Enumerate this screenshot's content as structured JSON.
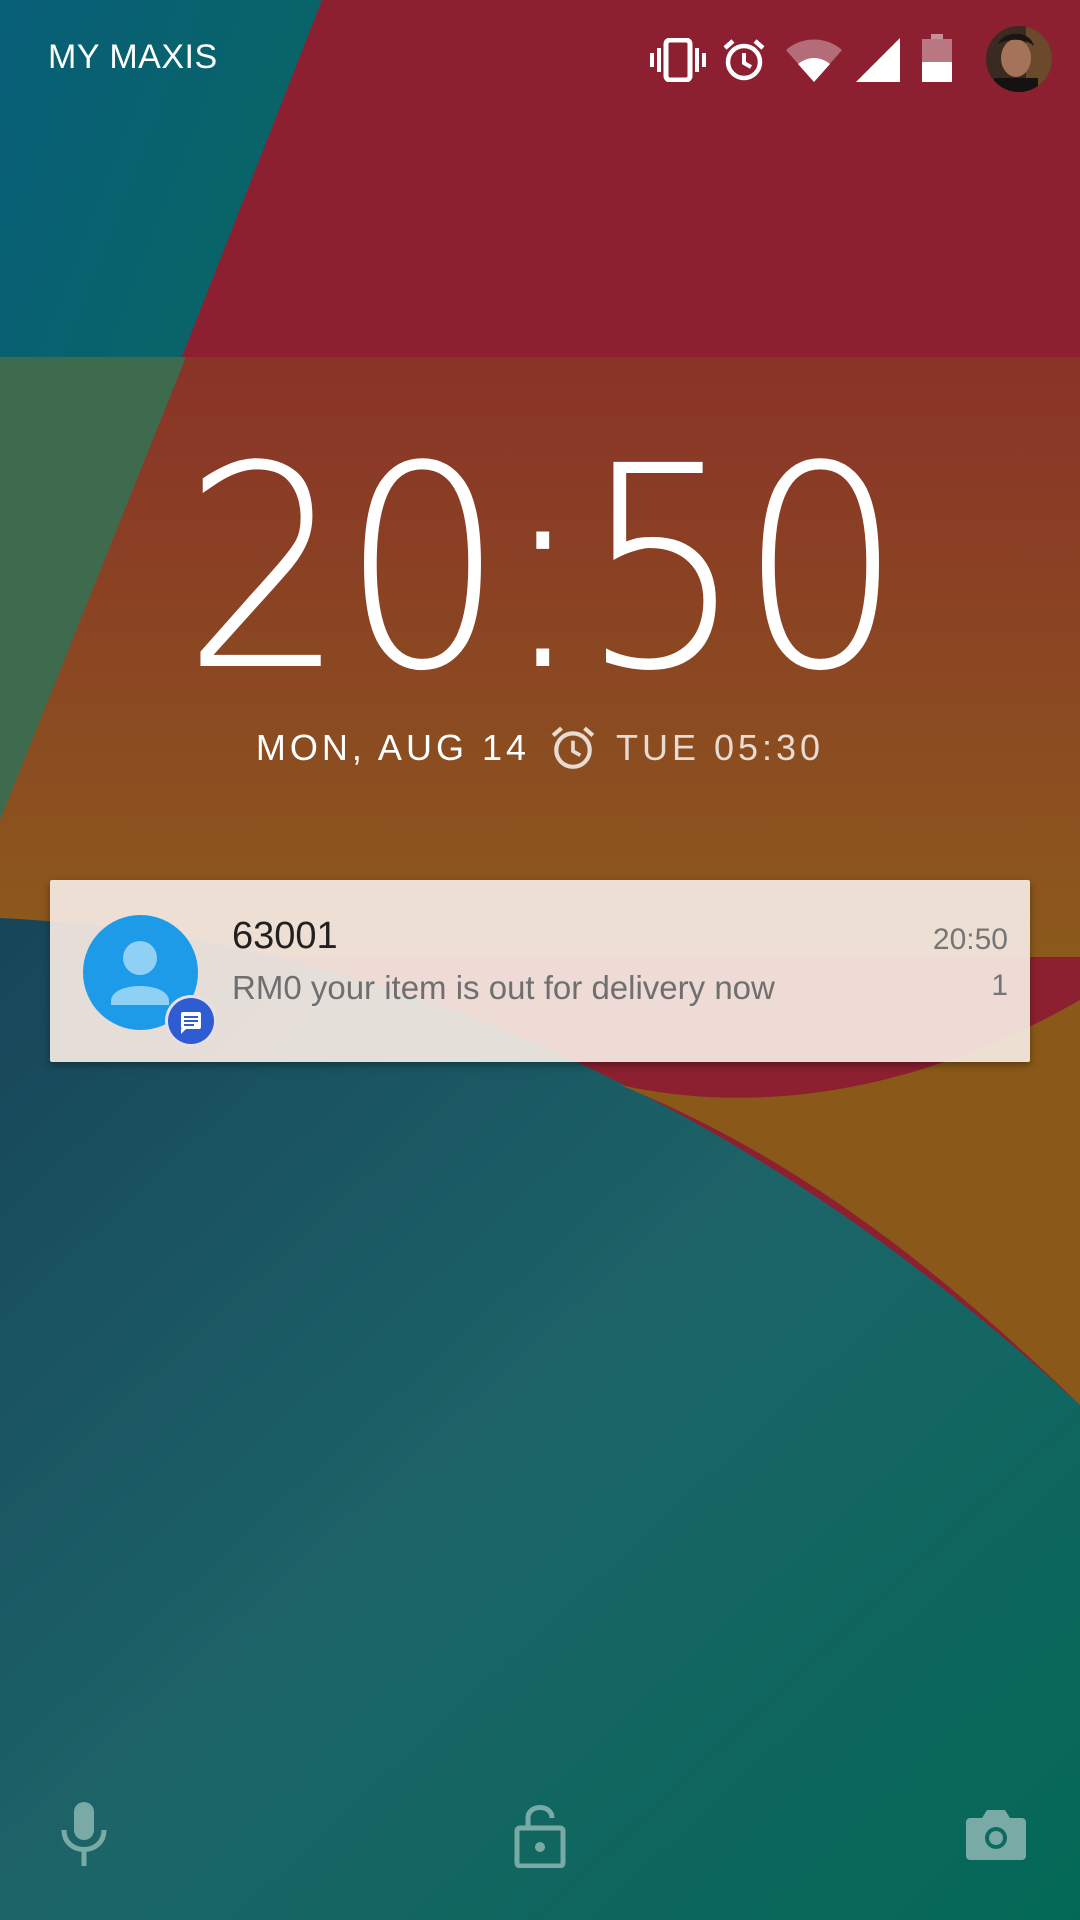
{
  "status_bar": {
    "carrier": "MY MAXIS",
    "icons": [
      "vibrate-icon",
      "alarm-icon",
      "wifi-icon",
      "signal-icon",
      "battery-icon",
      "user-avatar"
    ]
  },
  "lockscreen": {
    "time": "20:50",
    "date": "MON, AUG 14",
    "next_alarm": "TUE 05:30"
  },
  "notification": {
    "title": "63001",
    "text": "RM0 your item is out for delivery now",
    "time": "20:50",
    "count": "1",
    "avatar_color": "#1e9be8",
    "badge_color": "#2f5bd3",
    "app_icon": "message-icon"
  },
  "bottom_bar": {
    "left_icon": "microphone-icon",
    "center_icon": "lock-icon",
    "right_icon": "camera-icon"
  },
  "colors": {
    "wallpaper_red": "#8c2030",
    "wallpaper_teal": "#146463",
    "wallpaper_amber": "#8a5a1a"
  }
}
